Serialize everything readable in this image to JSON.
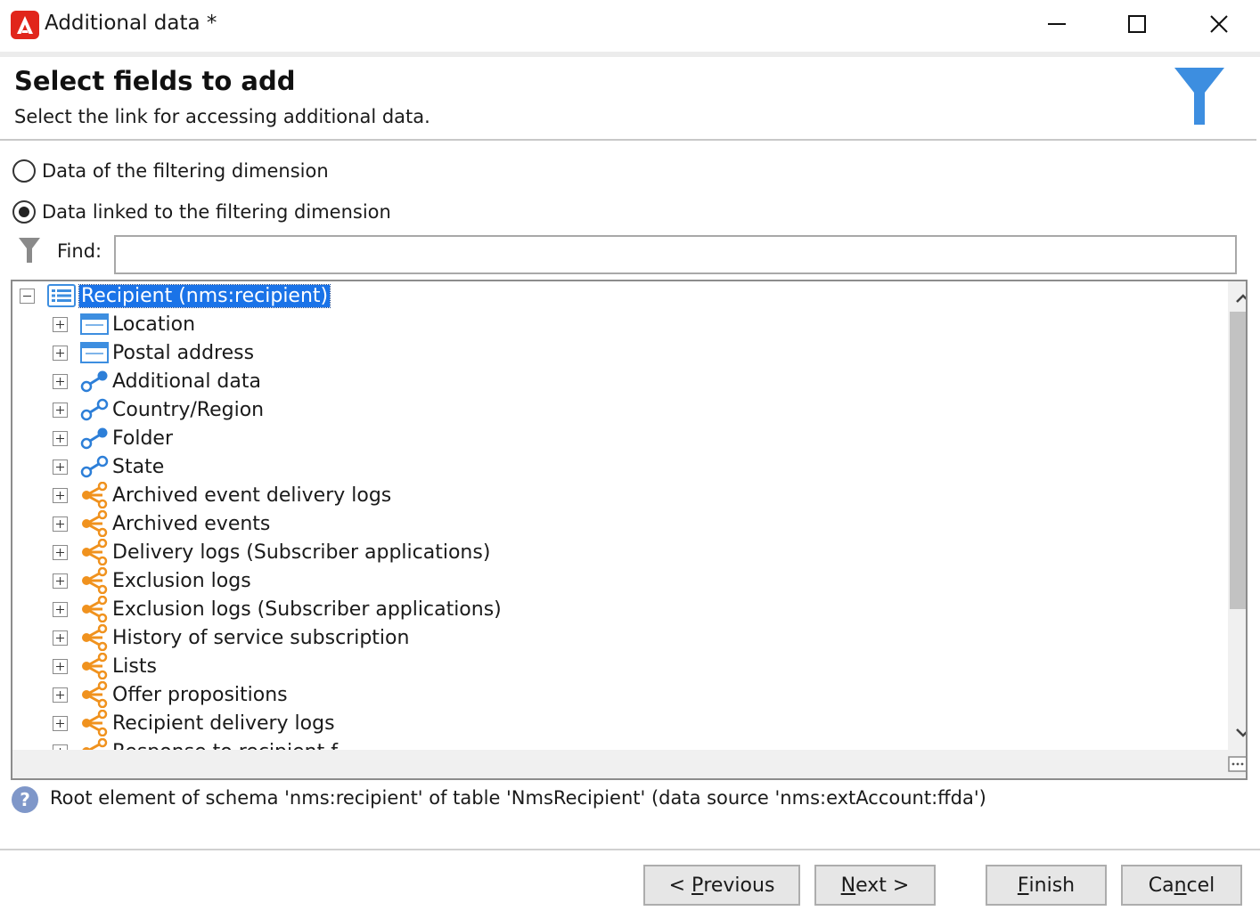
{
  "window": {
    "title": "Additional data *",
    "controls": [
      "minimize-icon",
      "maximize-icon",
      "close-icon"
    ]
  },
  "header": {
    "title": "Select fields to add",
    "subtitle": "Select the link for accessing additional data.",
    "icon": "funnel-icon",
    "icon_color": "#3d8ee0"
  },
  "options": {
    "radio_filtering_dimension": "Data of the filtering dimension",
    "radio_linked_dimension": "Data linked to the filtering dimension",
    "selected": "radio_linked_dimension"
  },
  "find": {
    "label": "Find:",
    "value": ""
  },
  "tree": {
    "root": {
      "label": "Recipient (nms:recipient)",
      "icon": "schema-list-icon",
      "expanded": true,
      "selected": true
    },
    "children": [
      {
        "label": "Location",
        "icon": "element-icon"
      },
      {
        "label": "Postal address",
        "icon": "element-icon"
      },
      {
        "label": "Additional data",
        "icon": "link-icon"
      },
      {
        "label": "Country/Region",
        "icon": "link-icon"
      },
      {
        "label": "Folder",
        "icon": "link-icon"
      },
      {
        "label": "State",
        "icon": "link-icon"
      },
      {
        "label": "Archived event delivery logs",
        "icon": "collection-link-icon"
      },
      {
        "label": "Archived events",
        "icon": "collection-link-icon"
      },
      {
        "label": "Delivery logs (Subscriber applications)",
        "icon": "collection-link-icon"
      },
      {
        "label": "Exclusion logs",
        "icon": "collection-link-icon"
      },
      {
        "label": "Exclusion logs (Subscriber applications)",
        "icon": "collection-link-icon"
      },
      {
        "label": "History of service subscription",
        "icon": "collection-link-icon"
      },
      {
        "label": "Lists",
        "icon": "collection-link-icon"
      },
      {
        "label": "Offer propositions",
        "icon": "collection-link-icon"
      },
      {
        "label": "Recipient delivery logs",
        "icon": "collection-link-icon"
      },
      {
        "label": "Response to recipient f...",
        "icon": "collection-link-icon"
      }
    ],
    "colors": {
      "link": "#2d7fd8",
      "collection_link": "#f0921e",
      "selection": "#1a73e8"
    }
  },
  "info": {
    "icon": "help-icon",
    "text": "Root element of schema 'nms:recipient' of table 'NmsRecipient' (data source 'nms:extAccount:ffda')"
  },
  "buttons": {
    "previous": {
      "prefix": "< ",
      "mnemonic": "P",
      "rest": "revious"
    },
    "next": {
      "mnemonic": "N",
      "rest": "ext >"
    },
    "finish": {
      "mnemonic": "F",
      "rest": "inish"
    },
    "cancel": {
      "prefix": "Ca",
      "mnemonic": "n",
      "rest": "cel"
    }
  }
}
